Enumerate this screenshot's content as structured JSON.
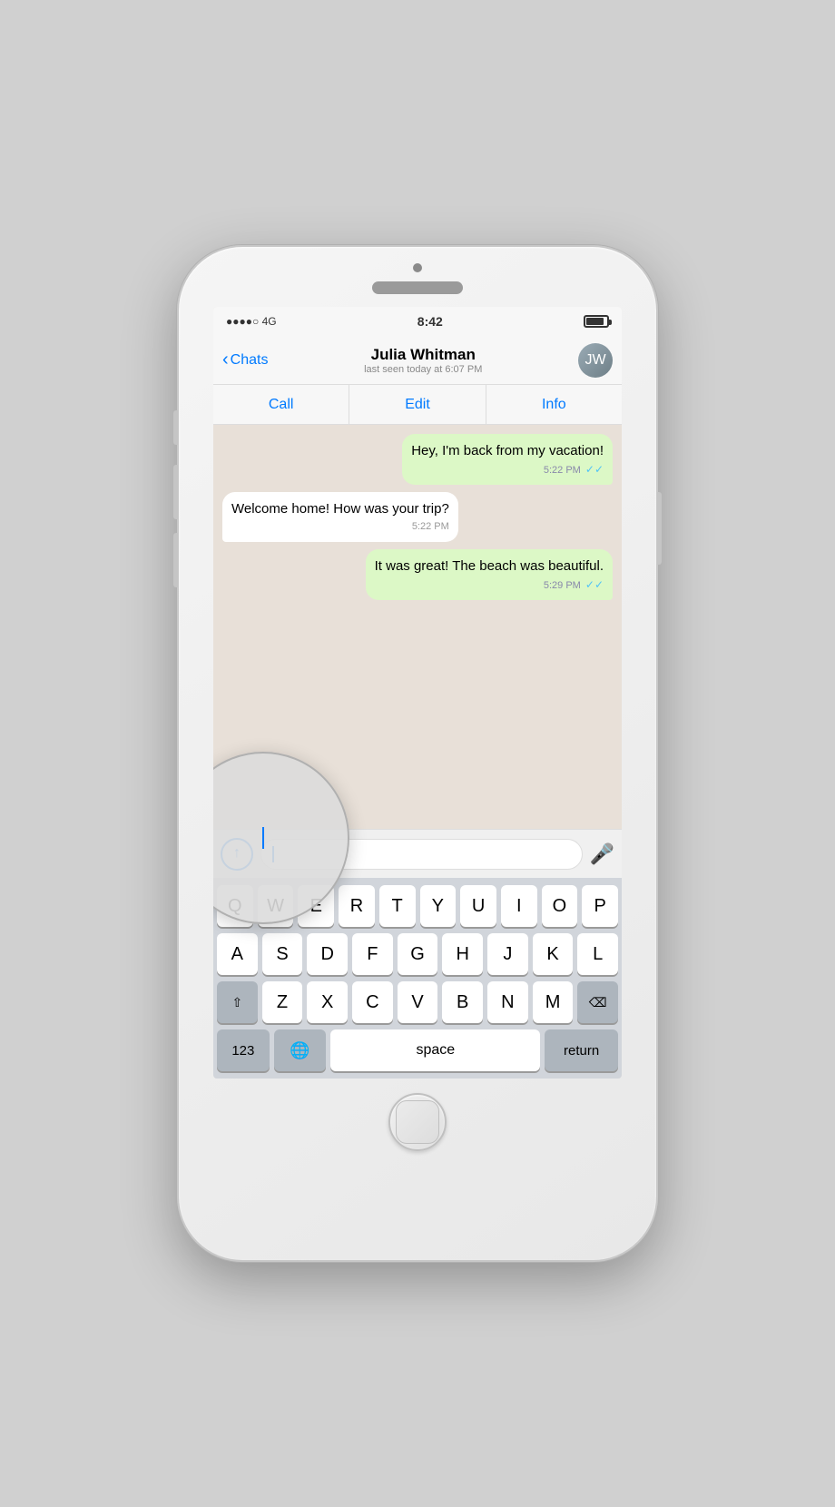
{
  "status_bar": {
    "signal": "●●●●○ 4G",
    "time": "8:42",
    "battery_label": "battery"
  },
  "nav": {
    "back_label": "Chats",
    "contact_name": "Julia Whitman",
    "last_seen": "last seen today at 6:07 PM"
  },
  "action_buttons": {
    "call": "Call",
    "edit": "Edit",
    "info": "Info"
  },
  "messages": [
    {
      "id": "msg1",
      "type": "sent",
      "text": "Hey, I'm back from my vacation!",
      "time": "5:22 PM",
      "double_check": true
    },
    {
      "id": "msg2",
      "type": "received",
      "text": "Welcome home! How was your trip?",
      "time": "5:22 PM",
      "double_check": false
    },
    {
      "id": "msg3",
      "type": "sent",
      "text": "It was great! The beach was beautiful.",
      "time": "5:29 PM",
      "double_check": true
    }
  ],
  "input": {
    "placeholder": "",
    "current_value": ""
  },
  "keyboard": {
    "row1": [
      "Q",
      "W",
      "E",
      "R",
      "T",
      "Y",
      "U",
      "I",
      "O",
      "P"
    ],
    "row2": [
      "A",
      "S",
      "D",
      "F",
      "G",
      "H",
      "J",
      "K",
      "L"
    ],
    "row3": [
      "Z",
      "X",
      "C",
      "V",
      "B",
      "N",
      "M"
    ],
    "space_label": "space",
    "return_label": "return",
    "num_label": "123",
    "globe_label": "🌐",
    "delete_label": "⌫",
    "shift_label": "⇧"
  }
}
